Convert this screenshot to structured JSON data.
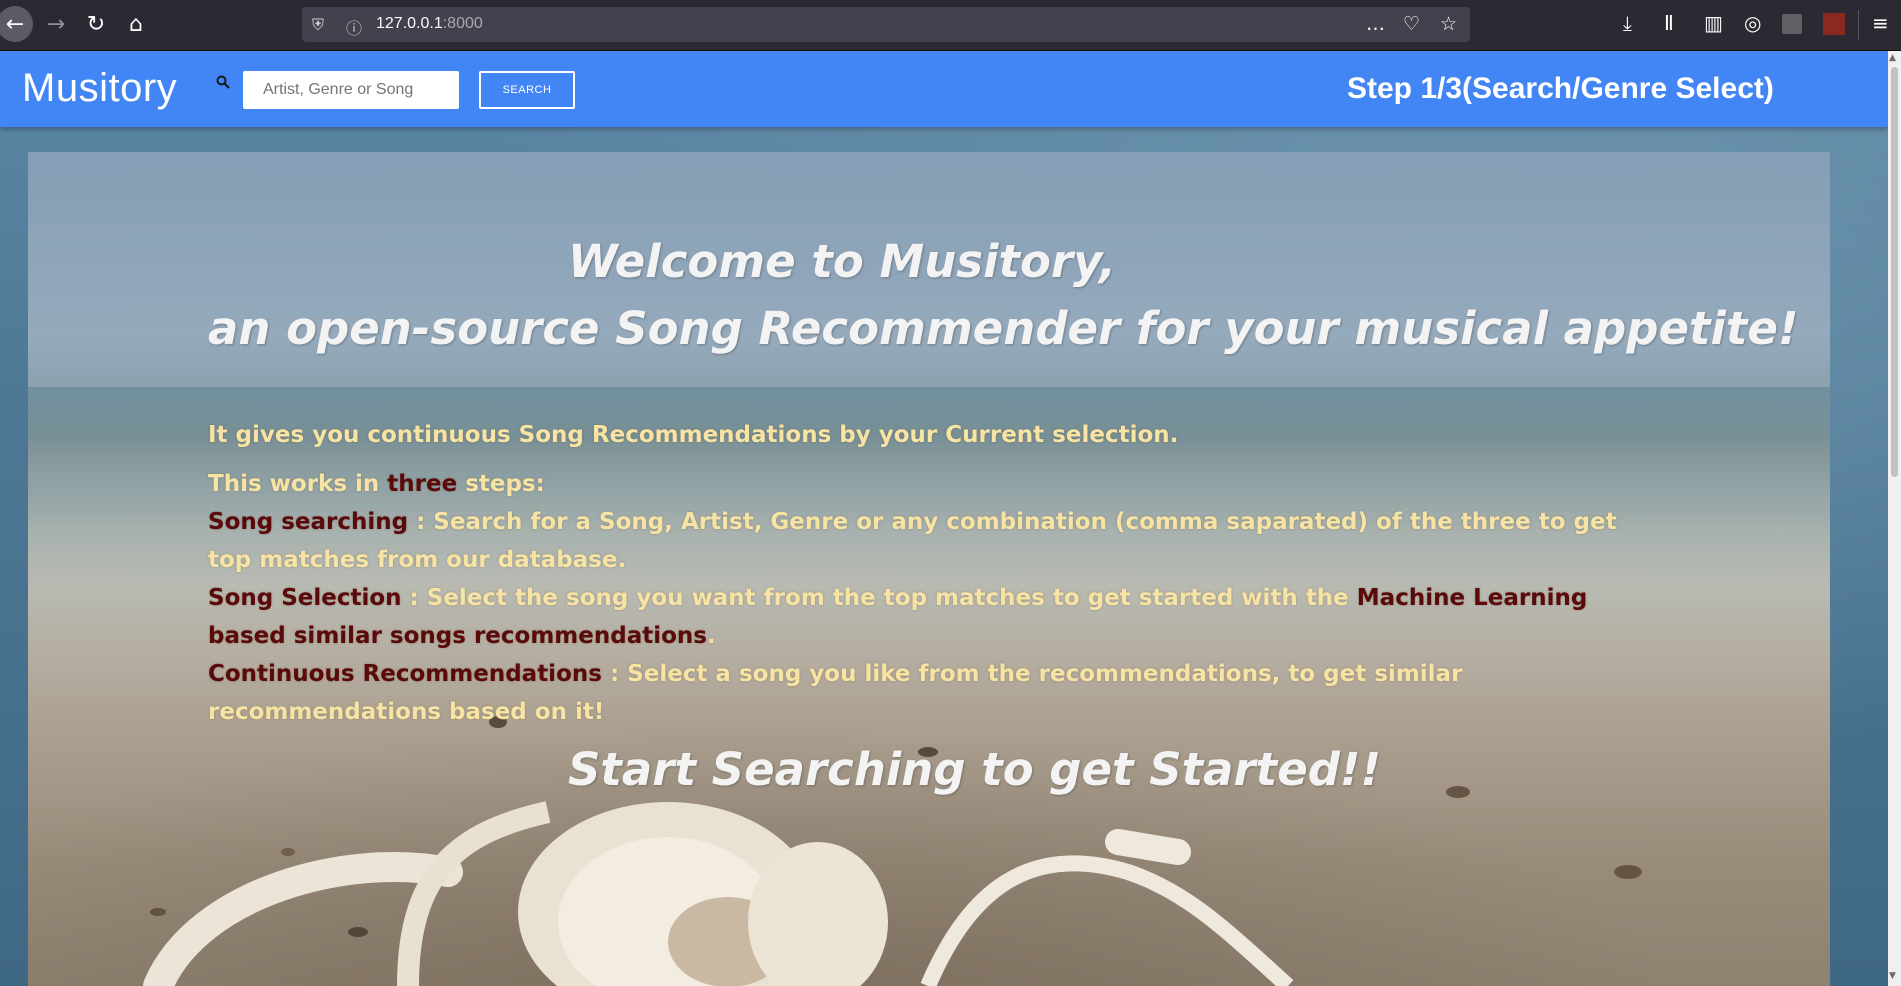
{
  "browser": {
    "url_host": "127.0.0.1",
    "url_port": ":8000",
    "icons": {
      "back": "back-arrow-icon",
      "forward": "forward-arrow-icon",
      "reload": "reload-icon",
      "home": "home-icon",
      "shield": "tracking-protection-shield-icon",
      "info": "site-info-icon",
      "more": "more-actions-icon",
      "pocket": "pocket-icon",
      "bookmark": "bookmark-star-icon",
      "download": "download-icon",
      "library": "library-icon",
      "sidebar": "sidebar-icon",
      "account": "account-icon",
      "menu": "hamburger-menu-icon"
    }
  },
  "navbar": {
    "brand": "Musitory",
    "search_placeholder": "Artist, Genre or Song",
    "search_button": "SEARCH",
    "step_title": "Step 1/3(Search/Genre Select)",
    "background_color": "#4285f4"
  },
  "hero": {
    "welcome_line1": "Welcome to Musitory,",
    "welcome_line2": "an open-source Song Recommender for your musical appetite!",
    "intro": "It gives you continuous Song Recommendations by your Current selection.",
    "steps_intro_prefix": "This works in ",
    "steps_intro_highlight": "three",
    "steps_intro_suffix": " steps:",
    "step1_label": "Song searching",
    "step1_text": " : Search for a Song, Artist, Genre or any combination (comma saparated) of the three to get top matches from our database.",
    "step2_label": "Song Selection",
    "step2_text": " : Select the song you want from the top matches to get started with the ",
    "step2_highlight": "Machine Learning based similar songs recommendations",
    "step2_end": ".",
    "step3_label": "Continuous Recommendations",
    "step3_text": " : Select a song you like from the recommendations, to get similar recommendations based on it!",
    "start": "Start Searching to get Started!!",
    "text_color": "#f7e3a4",
    "highlight_color": "#5a0a0a"
  }
}
